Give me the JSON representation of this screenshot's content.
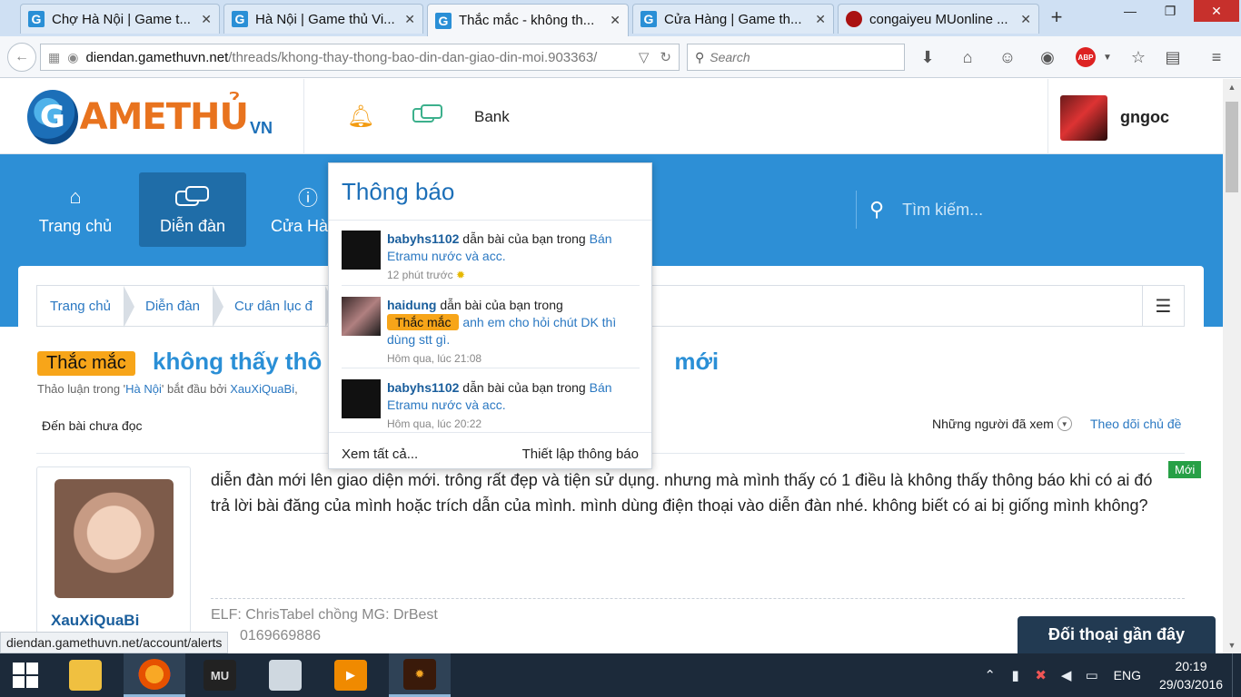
{
  "browser": {
    "tabs": [
      {
        "label": "Chợ Hà Nội | Game t...",
        "favicon": "G"
      },
      {
        "label": "Hà Nội | Game thủ Vi...",
        "favicon": "G"
      },
      {
        "label": "Thắc mắc - không th...",
        "favicon": "G"
      },
      {
        "label": "Cửa Hàng | Game th...",
        "favicon": "G"
      },
      {
        "label": "congaiyeu MUonline ...",
        "favicon": "mu-icon"
      }
    ],
    "active_tab_index": 2,
    "url_domain": "diendan.gamethuvn.net",
    "url_path": "/threads/khong-thay-thong-bao-din-dan-giao-din-moi.903363/",
    "search_placeholder": "Search"
  },
  "site": {
    "logo_text": "AMETHỦ",
    "logo_letter": "G",
    "logo_suffix": "VN",
    "bank_label": "Bank",
    "username": "gngoc",
    "nav": [
      {
        "label": "Trang chủ",
        "icon": "home-icon"
      },
      {
        "label": "Diễn đàn",
        "icon": "chat-bubbles-icon"
      },
      {
        "label": "Cửa Hà",
        "icon": "help-icon"
      }
    ],
    "search_placeholder": "Tìm kiếm..."
  },
  "breadcrumb": [
    "Trang chủ",
    "Diễn đàn",
    "Cư dân lục đ"
  ],
  "thread": {
    "prefix": "Thắc mắc",
    "title": "không thấy thô",
    "title_tail": "mới",
    "meta_prefix": "Thảo luận trong '",
    "meta_forum": "Hà Nội",
    "meta_mid": "' bắt đầu bởi ",
    "meta_author": "XauXiQuaBi",
    "meta_tail": ",",
    "goto_unread": "Đến bài chưa đọc",
    "watchers": "Những người đã xem",
    "watch_thread": "Theo dõi chủ đề"
  },
  "post": {
    "author": "XauXiQuaBi",
    "body": "diễn đàn mới lên giao diện mới. trông rất đẹp và tiện sử dụng. nhưng mà mình thấy có 1 điều là không thấy thông báo khi có ai đó trả lời bài đăng của mình hoặc trích dẫn của mình. mình dùng điện thoại vào diễn đàn nhé. không biết có ai bị giống mình không?",
    "new_badge": "Mới",
    "signature": "ELF: ChrisTabel chồng MG: DrBest",
    "signature_phone": "0169669886"
  },
  "alerts": {
    "title": "Thông báo",
    "items": [
      {
        "user": "babyhs1102",
        "action": " dẫn bài của bạn trong ",
        "prefix": "",
        "thread": "Bán Etramu nước và acc.",
        "time": "12 phút trước"
      },
      {
        "user": "haidung",
        "action": " dẫn bài của bạn trong ",
        "prefix": "Thắc mắc",
        "thread": "anh em cho hỏi chút DK thì dùng stt gì.",
        "time": "Hôm qua, lúc 21:08"
      },
      {
        "user": "babyhs1102",
        "action": " dẫn bài của bạn trong ",
        "prefix": "",
        "thread": "Bán Etramu nước và acc.",
        "time": "Hôm qua, lúc 20:22"
      }
    ],
    "see_all": "Xem tất cả...",
    "preferences": "Thiết lập thông báo"
  },
  "recent_chat": "Đối thoại gần đây",
  "status_url": "diendan.gamethuvn.net/account/alerts",
  "taskbar": {
    "lang": "ENG",
    "time": "20:19",
    "date": "29/03/2016"
  },
  "colors": {
    "brand_blue": "#2d8fd6",
    "brand_orange": "#e8731e",
    "prefix_orange": "#f7a519",
    "new_green": "#27a046"
  }
}
